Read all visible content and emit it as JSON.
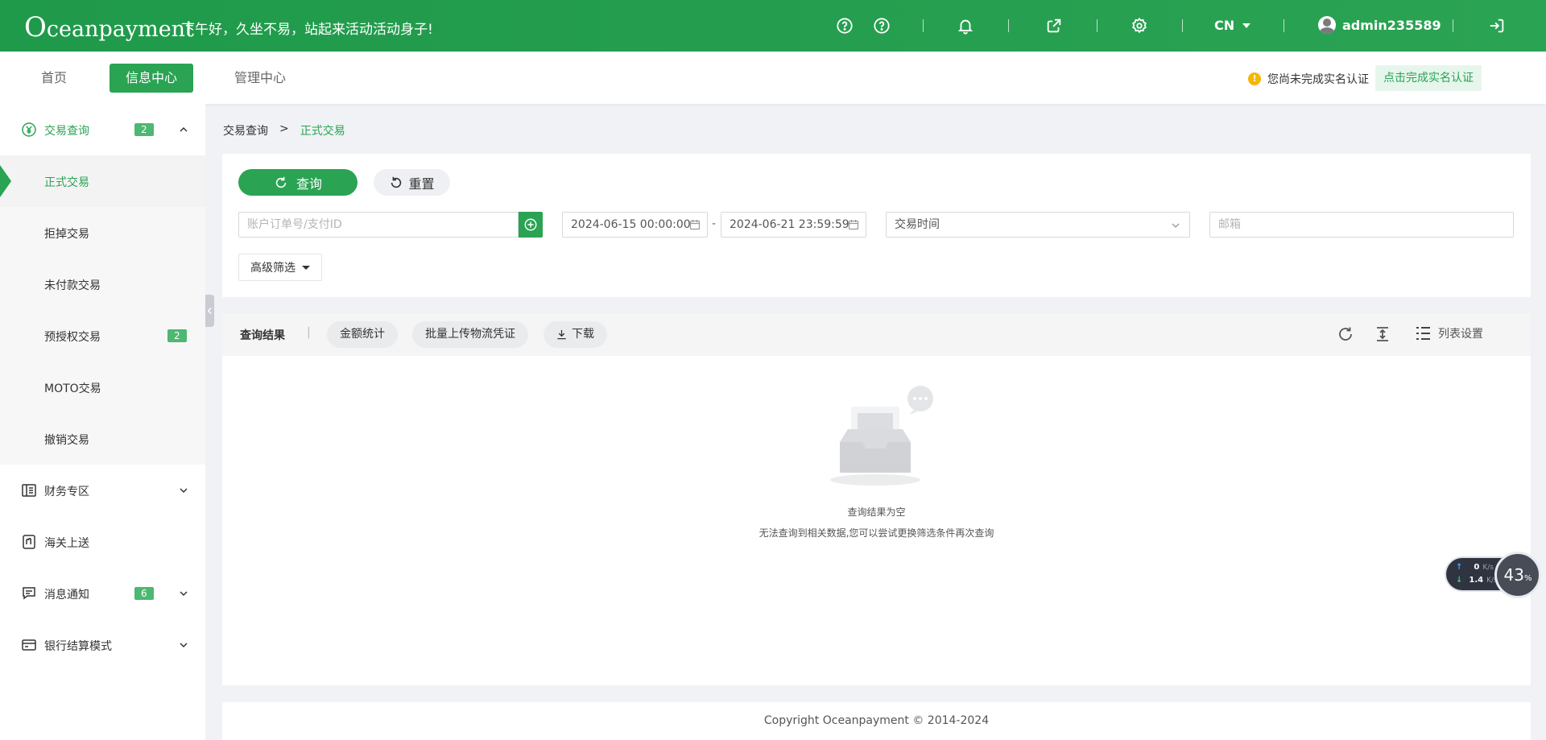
{
  "header": {
    "logo": "Oceanpayment",
    "greeting": "下午好，久坐不易，站起来活动活动身子!",
    "language": "CN",
    "username": "admin235589"
  },
  "nav": {
    "tabs": [
      {
        "label": "首页",
        "active": false
      },
      {
        "label": "信息中心",
        "active": true
      },
      {
        "label": "管理中心",
        "active": false
      }
    ],
    "notice_icon": "!",
    "notice_text": "您尚未完成实名认证",
    "verify_button": "点击完成实名认证"
  },
  "sidebar": {
    "groups": [
      {
        "label": "交易查询",
        "badge": "2",
        "icon": "yen-circle-icon",
        "expanded": true
      },
      {
        "label": "财务专区",
        "icon": "ledger-icon"
      },
      {
        "label": "海关上送",
        "icon": "customs-icon"
      },
      {
        "label": "消息通知",
        "badge": "6",
        "icon": "message-icon"
      },
      {
        "label": "银行结算模式",
        "icon": "bank-card-icon"
      }
    ],
    "sub_items": [
      {
        "label": "正式交易",
        "active": true
      },
      {
        "label": "拒掉交易"
      },
      {
        "label": "未付款交易"
      },
      {
        "label": "预授权交易",
        "badge": "2"
      },
      {
        "label": "MOTO交易"
      },
      {
        "label": "撤销交易"
      }
    ]
  },
  "breadcrumb": {
    "parent": "交易查询",
    "separator": ">",
    "current": "正式交易"
  },
  "filters": {
    "query_button": "查询",
    "reset_button": "重置",
    "order_placeholder": "账户订单号/支付ID",
    "start_date": "2024-06-15 00:00:00",
    "date_separator": "-",
    "end_date": "2024-06-21 23:59:59",
    "time_type": "交易时间",
    "email_placeholder": "邮箱",
    "advanced_button": "高级筛选"
  },
  "results": {
    "title": "查询结果",
    "pipe": "|",
    "amount_stats": "金额统计",
    "batch_upload": "批量上传物流凭证",
    "download": "下载",
    "column_settings": "列表设置",
    "empty_title": "查询结果为空",
    "empty_desc": "无法查询到相关数据,您可以尝试更换筛选条件再次查询"
  },
  "speed_widget": {
    "upload": "0",
    "upload_unit": "K/s",
    "download": "1.4",
    "download_unit": "K/s",
    "percent": "43",
    "percent_unit": "%"
  },
  "footer": {
    "copyright": "Copyright Oceanpayment © 2014-2024"
  },
  "colors": {
    "brand": "#2aa353",
    "warning": "#f5b700"
  }
}
